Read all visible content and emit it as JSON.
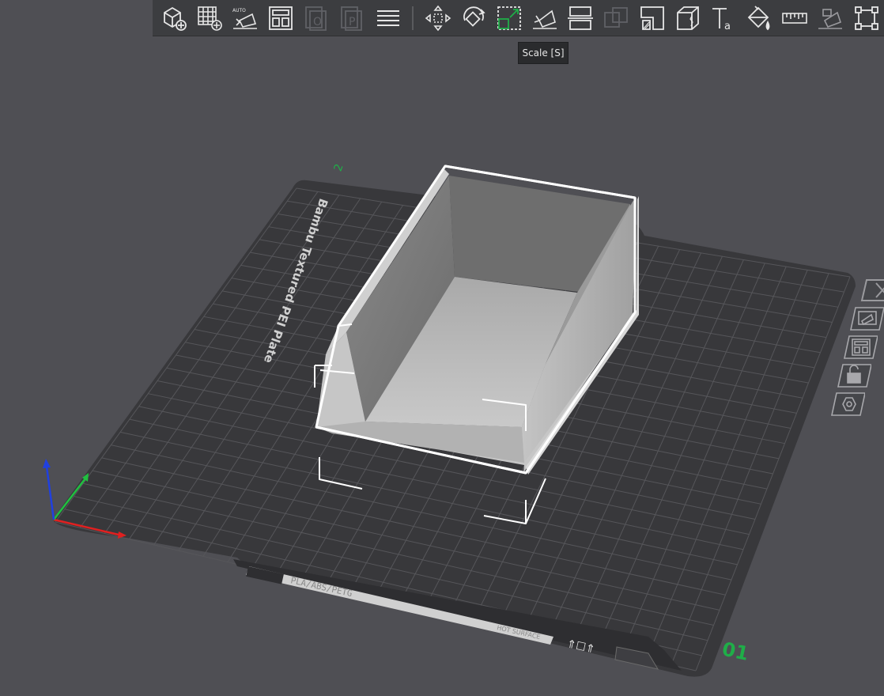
{
  "toolbar": {
    "tools": [
      {
        "name": "add-object-button",
        "icon": "cube-plus-icon"
      },
      {
        "name": "add-plate-button",
        "icon": "grid-plus-icon"
      },
      {
        "name": "auto-orient-button",
        "icon": "auto-orient-icon",
        "label": "AUTO"
      },
      {
        "name": "arrange-button",
        "icon": "arrange-icon"
      },
      {
        "name": "split-objects-button",
        "icon": "split-objects-icon"
      },
      {
        "name": "split-parts-button",
        "icon": "split-parts-icon"
      },
      {
        "name": "variable-layer-height-button",
        "icon": "layers-icon"
      },
      {
        "name": "move-button",
        "icon": "move-icon"
      },
      {
        "name": "rotate-button",
        "icon": "rotate-icon"
      },
      {
        "name": "scale-button",
        "icon": "scale-icon"
      },
      {
        "name": "lay-on-face-button",
        "icon": "lay-on-face-icon"
      },
      {
        "name": "cut-button",
        "icon": "cut-icon"
      },
      {
        "name": "boolean-button",
        "icon": "boolean-icon"
      },
      {
        "name": "support-painting-button",
        "icon": "support-paint-icon"
      },
      {
        "name": "seam-painting-button",
        "icon": "seam-paint-icon"
      },
      {
        "name": "text-button",
        "icon": "text-icon"
      },
      {
        "name": "color-painting-button",
        "icon": "paint-bucket-icon"
      },
      {
        "name": "measure-button",
        "icon": "ruler-icon"
      },
      {
        "name": "assembly-button",
        "icon": "assembly-icon"
      },
      {
        "name": "mesh-boolean-button",
        "icon": "frame-icon"
      }
    ],
    "tooltip": "Scale [S]"
  },
  "plate": {
    "name": "Bambu Textured PEI Plate",
    "filaments": "PLA/ABS/PETG",
    "surface_warning": "HOT SURFACE",
    "plate_number": "01",
    "corner_marker": "2"
  },
  "side_tools": [
    {
      "name": "close-plate-button",
      "icon": "close-icon"
    },
    {
      "name": "auto-orient-plate-button",
      "icon": "auto-orient-icon"
    },
    {
      "name": "arrange-plate-button",
      "icon": "arrange-icon"
    },
    {
      "name": "lock-plate-button",
      "icon": "lock-icon"
    },
    {
      "name": "plate-settings-button",
      "icon": "hexagon-settings-icon"
    }
  ],
  "colors": {
    "background": "#4f4f54",
    "plate": "#38383b",
    "grid": "#5a5a5e",
    "object": "#b9b9b9",
    "selection": "#ffffff",
    "axis_x": "#e02020",
    "axis_y": "#20c040",
    "axis_z": "#2040e0",
    "plate_number": "#1fae48"
  }
}
